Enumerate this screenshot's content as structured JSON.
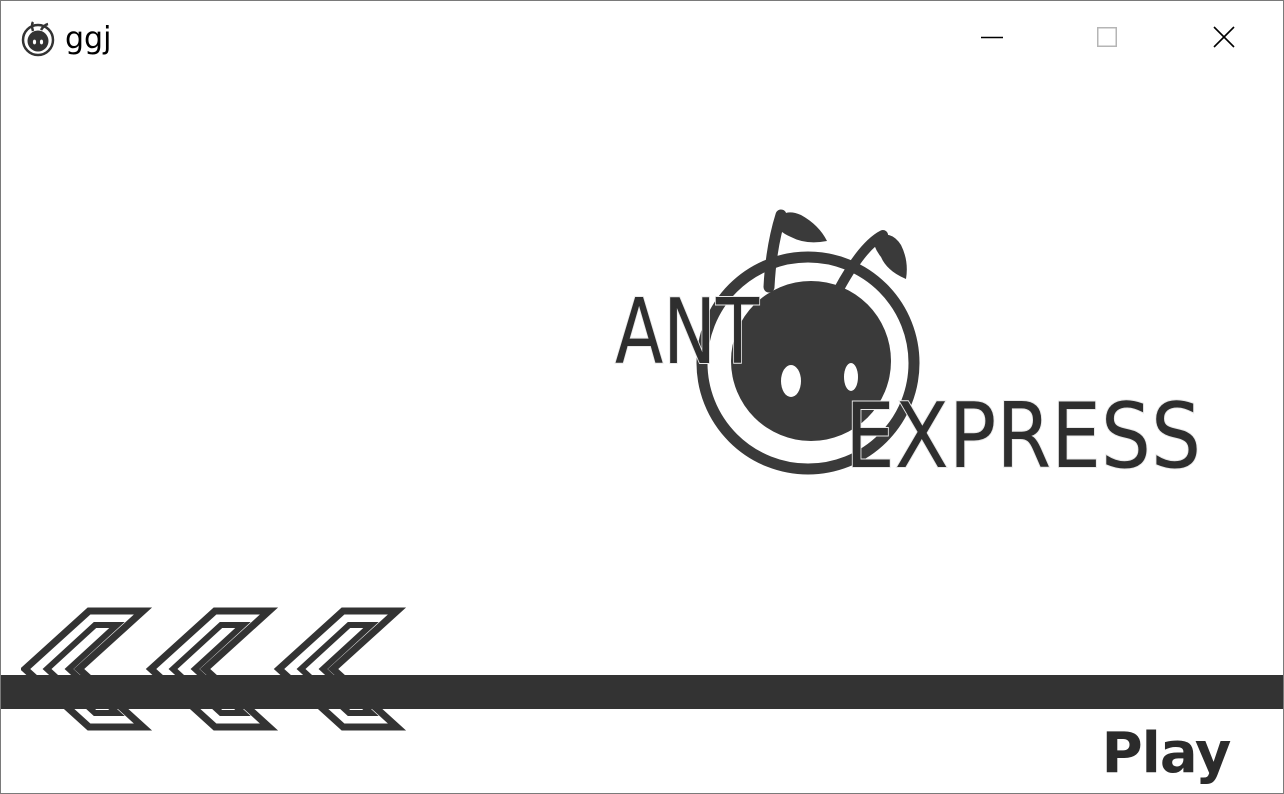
{
  "window": {
    "title": "ggj",
    "app_icon": "ant-head-icon",
    "controls": [
      "minimize-icon",
      "maximize-icon",
      "close-icon"
    ]
  },
  "logo": {
    "word_top": "ANT",
    "word_bottom": "EXPRESS",
    "icon": "ant-head-icon"
  },
  "decor": {
    "chevron_count": 3,
    "chevron_icon": "double-chevron-left-icon"
  },
  "menu": {
    "play_label": "Play"
  },
  "colors": {
    "dark": "#333333",
    "background": "#ffffff"
  }
}
